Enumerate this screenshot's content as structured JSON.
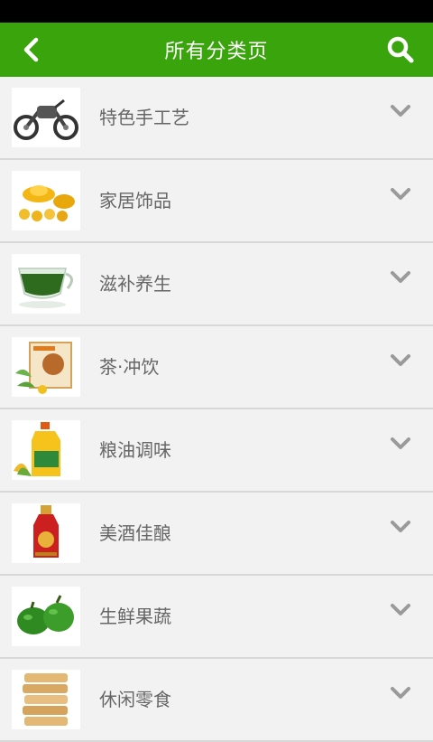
{
  "header": {
    "title": "所有分类页",
    "back_icon": "back-arrow-icon",
    "search_icon": "search-icon"
  },
  "categories": [
    {
      "label": "特色手工艺",
      "thumb": "motorcycle-craft-image"
    },
    {
      "label": "家居饰品",
      "thumb": "gold-ingots-image"
    },
    {
      "label": "滋补养生",
      "thumb": "herbal-tea-cup-image"
    },
    {
      "label": "茶·冲饮",
      "thumb": "tea-drink-box-image"
    },
    {
      "label": "粮油调味",
      "thumb": "cooking-oil-bottle-image"
    },
    {
      "label": "美酒佳酿",
      "thumb": "liquor-bottle-image"
    },
    {
      "label": "生鲜果蔬",
      "thumb": "green-peppers-image"
    },
    {
      "label": "休闲零食",
      "thumb": "snack-crackers-image"
    }
  ],
  "colors": {
    "header_bg": "#3aa40c",
    "background": "#f2f2f2",
    "label": "#666666",
    "chevron": "#9a9a9a"
  }
}
